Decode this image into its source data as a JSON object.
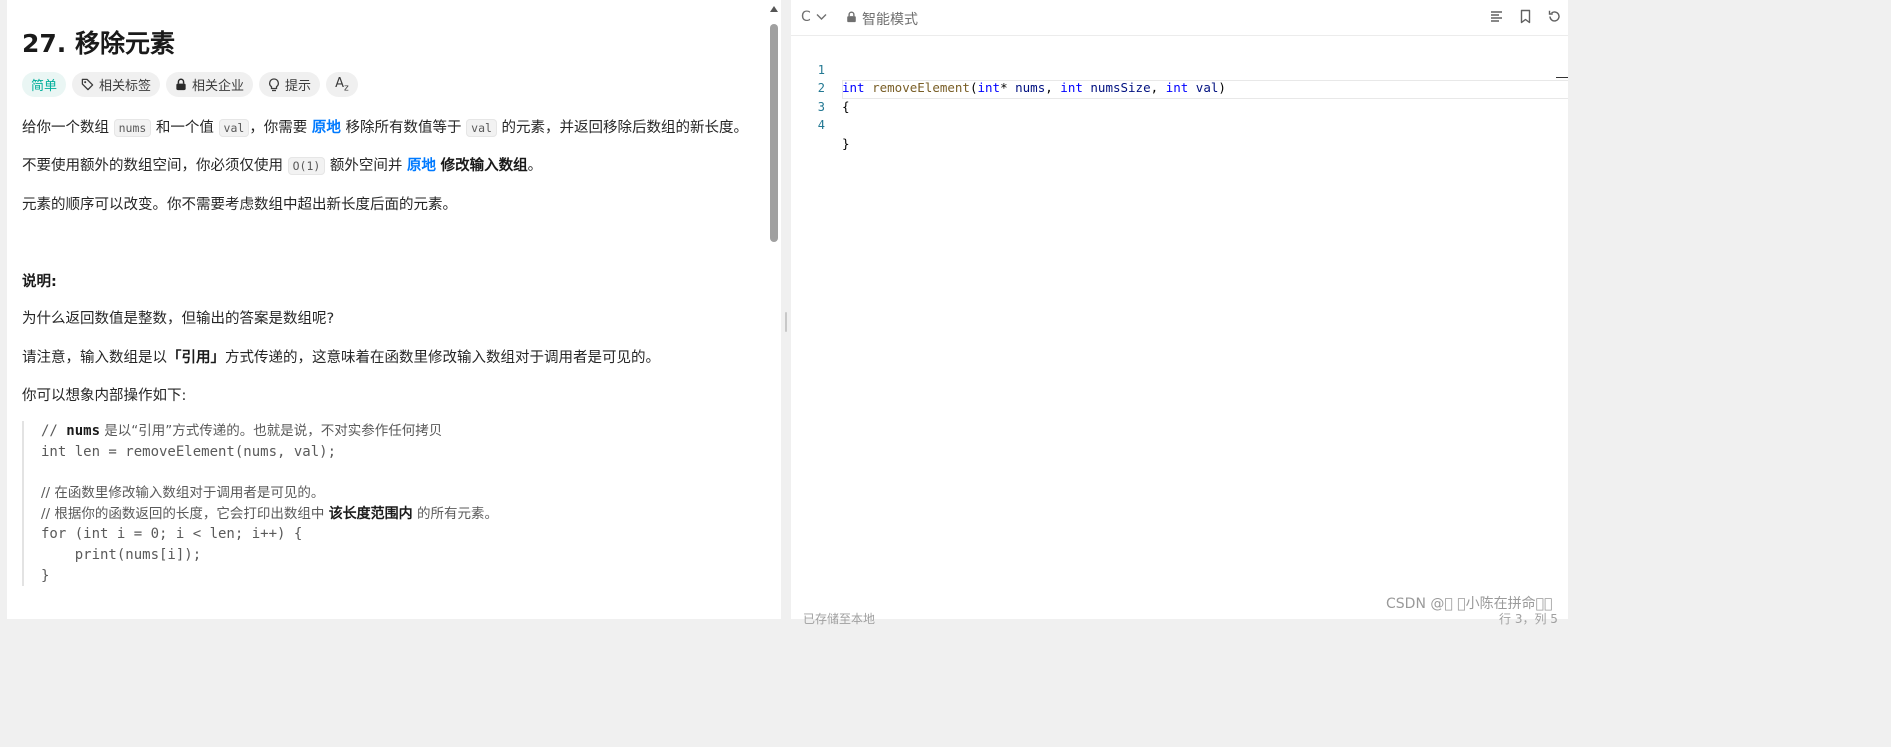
{
  "problem": {
    "title": "27. 移除元素",
    "tags": [
      {
        "label": "简单",
        "icon": "none"
      },
      {
        "label": "相关标签",
        "icon": "tag-icon"
      },
      {
        "label": "相关企业",
        "icon": "lock-icon"
      },
      {
        "label": "提示",
        "icon": "lightbulb-icon"
      },
      {
        "label": "",
        "icon": "translate-icon"
      }
    ],
    "translate_glyph": "A",
    "p1": {
      "t1": "给你一个数组 ",
      "c1": "nums",
      "t2": " 和一个值 ",
      "c2": "val",
      "t3": "，你需要 ",
      "hl": "原地",
      "t4": " 移除所有数值等于 ",
      "c3": "val",
      "t5": " 的元素，并返回移除后数组的新长度。"
    },
    "p2": {
      "t1": "不要使用额外的数组空间，你必须仅使用 ",
      "c1": "O(1)",
      "t2": " 额外空间并 ",
      "hl": "原地",
      "t3": " ",
      "b": "修改输入数组",
      "t4": "。"
    },
    "p3": "元素的顺序可以改变。你不需要考虑数组中超出新长度后面的元素。",
    "note_heading": "说明:",
    "p4": "为什么返回数值是整数，但输出的答案是数组呢?",
    "p5": {
      "t1": "请注意，输入数组是以",
      "b": "「引用」",
      "t2": "方式传递的，这意味着在函数里修改输入数组对于调用者是可见的。"
    },
    "p6": "你可以想象内部操作如下:",
    "code": {
      "l1a": "// ",
      "l1b": "nums",
      "l1c": " 是以“引用”方式传递的。也就是说，不对实参作任何拷贝",
      "l2": "int len = removeElement(nums, val);",
      "l3": "",
      "l4": "// 在函数里修改输入数组对于调用者是可见的。",
      "l5a": "// 根据你的函数返回的长度，它会打印出数组中 ",
      "l5b": "该长度范围内",
      "l5c": " 的所有元素。",
      "l6": "for (int i = 0; i < len; i++) {",
      "l7": "    print(nums[i]);",
      "l8": "}"
    }
  },
  "editor": {
    "language": "C",
    "mode": "智能模式",
    "lines": [
      {
        "num": "1"
      },
      {
        "num": "2",
        "text": "{"
      },
      {
        "num": "3",
        "text": ""
      },
      {
        "num": "4",
        "text": "}"
      }
    ],
    "line1": {
      "kw1": "int",
      "fn": "removeElement",
      "p1": "(",
      "kw2": "int",
      "p2": "* ",
      "v1": "nums",
      "p3": ", ",
      "kw3": "int",
      "p4": " ",
      "v2": "numsSize",
      "p5": ", ",
      "kw4": "int",
      "p6": " ",
      "v3": "val",
      "p7": ")"
    },
    "status_left": "已存储至本地",
    "status_right": "行 3，列 5"
  },
  "watermark": "CSDN @\u0000 \u0000小陈在拼命\u0000\u0000"
}
